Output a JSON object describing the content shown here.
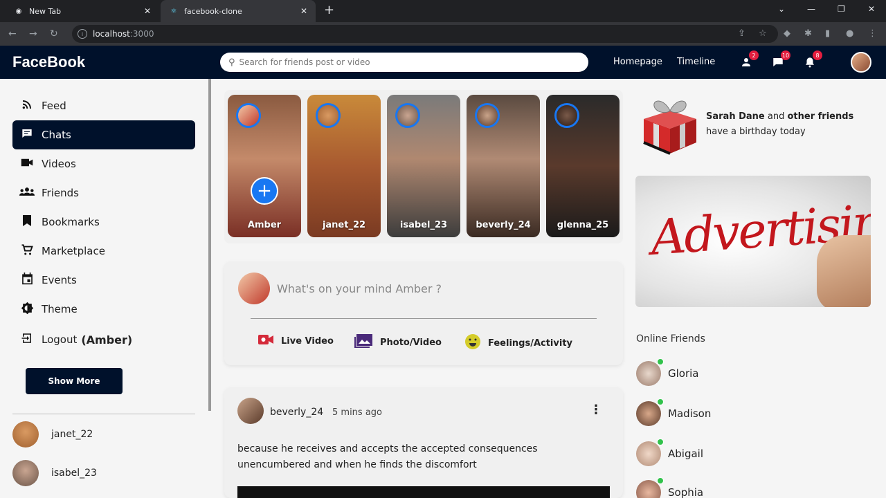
{
  "browser": {
    "tabs": [
      {
        "title": "New Tab",
        "active": false
      },
      {
        "title": "facebook-clone",
        "active": true
      }
    ],
    "url_host": "localhost",
    "url_port": ":3000"
  },
  "header": {
    "logo": "FaceBook",
    "search_placeholder": "Search for friends post or video",
    "nav": [
      "Homepage",
      "Timeline"
    ],
    "badges": {
      "friend_requests": "2",
      "messages": "10",
      "notifications": "8"
    }
  },
  "sidebar": {
    "items": [
      {
        "label": "Feed",
        "icon": "rss-icon"
      },
      {
        "label": "Chats",
        "icon": "chat-icon",
        "active": true
      },
      {
        "label": "Videos",
        "icon": "video-icon"
      },
      {
        "label": "Friends",
        "icon": "group-icon"
      },
      {
        "label": "Bookmarks",
        "icon": "bookmark-icon"
      },
      {
        "label": "Marketplace",
        "icon": "cart-icon"
      },
      {
        "label": "Events",
        "icon": "calendar-icon"
      },
      {
        "label": "Theme",
        "icon": "theme-icon"
      },
      {
        "label": "Logout",
        "icon": "logout-icon"
      }
    ],
    "logout_user": "(Amber)",
    "show_more": "Show More",
    "friends": [
      "janet_22",
      "isabel_23"
    ]
  },
  "stories": [
    {
      "name": "Amber"
    },
    {
      "name": "janet_22"
    },
    {
      "name": "isabel_23"
    },
    {
      "name": "beverly_24"
    },
    {
      "name": "glenna_25"
    }
  ],
  "share": {
    "prompt": "What's on your mind Amber ?",
    "options": [
      "Live Video",
      "Photo/Video",
      "Feelings/Activity"
    ]
  },
  "post": {
    "user": "beverly_24",
    "time": "5 mins ago",
    "text": "because he receives and accepts the accepted consequences unencumbered and when he finds the discomfort"
  },
  "right": {
    "birthday_name": "Sarah Dane",
    "birthday_and": " and ",
    "birthday_others": "other friends",
    "birthday_line2": "have a birthday today",
    "ad_text": "Advertising",
    "online_title": "Online Friends",
    "online": [
      "Gloria",
      "Madison",
      "Abigail",
      "Sophia"
    ]
  },
  "colors": {
    "header_bg": "#00112b",
    "accent": "#1877f2",
    "badge": "#e41e3f",
    "online": "#31c24b"
  }
}
